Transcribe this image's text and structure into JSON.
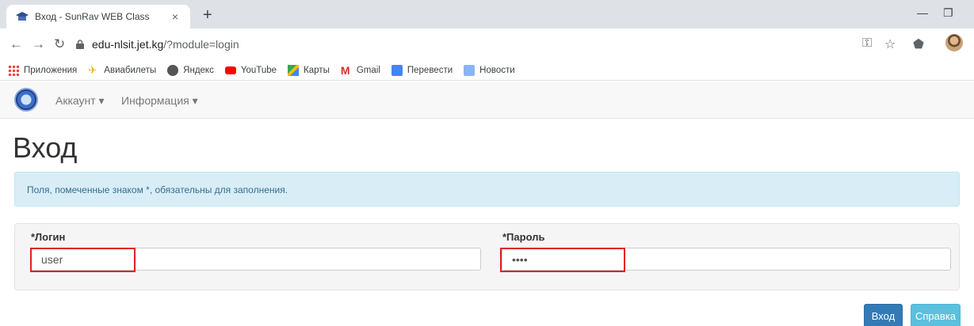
{
  "browser": {
    "tab_title": "Вход - SunRav WEB Class",
    "tab_close": "×",
    "new_tab": "+",
    "url_host": "edu-nlsit.jet.kg",
    "url_path": "/?module=login",
    "bookmarks": [
      {
        "label": "Приложения",
        "icon": "apps-grid-icon",
        "color": "#e8453c"
      },
      {
        "label": "Авиабилеты",
        "icon": "plane-icon",
        "color": "#f4b400"
      },
      {
        "label": "Яндекс",
        "icon": "yandex-icon",
        "color": "#555555"
      },
      {
        "label": "YouTube",
        "icon": "youtube-icon",
        "color": "#ff0000"
      },
      {
        "label": "Карты",
        "icon": "maps-icon",
        "color": "#34a853"
      },
      {
        "label": "Gmail",
        "icon": "gmail-icon",
        "color": "#d93025"
      },
      {
        "label": "Перевести",
        "icon": "translate-icon",
        "color": "#4285f4"
      },
      {
        "label": "Новости",
        "icon": "news-icon",
        "color": "#8ab4f8"
      }
    ]
  },
  "navbar": {
    "account": "Аккаунт ▾",
    "info": "Информация ▾"
  },
  "page": {
    "title": "Вход",
    "notice": "Поля, помеченные знаком *, обязательны для заполнения.",
    "login_label": "*Логин",
    "login_value": "user",
    "password_label": "*Пароль",
    "password_value": "••••",
    "submit_label": "Вход",
    "help_label": "Справка"
  },
  "colors": {
    "primary": "#337ab7",
    "info": "#5bc0de",
    "alert_bg": "#d9edf7",
    "highlight": "#e51c23"
  }
}
